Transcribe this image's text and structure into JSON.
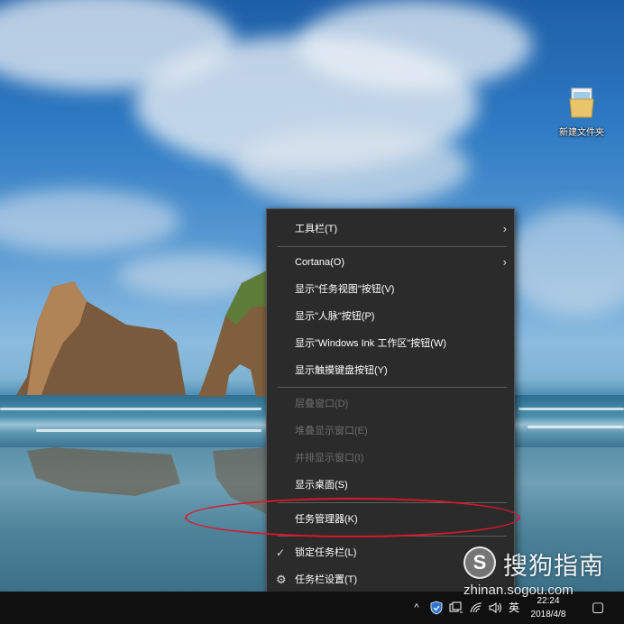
{
  "desktop": {
    "icon_label": "新建文件夹"
  },
  "menu": {
    "items": [
      {
        "label": "工具栏(T)",
        "has_submenu": true,
        "enabled": true
      },
      {
        "label": "Cortana(O)",
        "has_submenu": true,
        "enabled": true
      },
      {
        "label": "显示\"任务视图\"按钮(V)",
        "enabled": true
      },
      {
        "label": "显示\"人脉\"按钮(P)",
        "enabled": true
      },
      {
        "label": "显示\"Windows Ink 工作区\"按钮(W)",
        "enabled": true
      },
      {
        "label": "显示触摸键盘按钮(Y)",
        "enabled": true
      },
      {
        "label": "层叠窗口(D)",
        "enabled": false
      },
      {
        "label": "堆叠显示窗口(E)",
        "enabled": false
      },
      {
        "label": "并排显示窗口(I)",
        "enabled": false
      },
      {
        "label": "显示桌面(S)",
        "enabled": true
      },
      {
        "label": "任务管理器(K)",
        "enabled": true,
        "highlighted": true
      },
      {
        "label": "锁定任务栏(L)",
        "enabled": true,
        "checked": true
      },
      {
        "label": "任务栏设置(T)",
        "enabled": true,
        "icon": "gear-icon"
      }
    ],
    "submenu_glyph": "›",
    "check_glyph": "✓",
    "gear_glyph": "⚙",
    "highlight_color": "#d9192b"
  },
  "taskbar": {
    "tray": {
      "chevron": "^",
      "ime": "英",
      "notification_glyph": "▢"
    },
    "clock": {
      "time": "22:24",
      "date": "2018/4/8"
    }
  },
  "watermark": {
    "logo": "S",
    "title": "搜狗指南",
    "url": "zhinan.sogou.com"
  }
}
